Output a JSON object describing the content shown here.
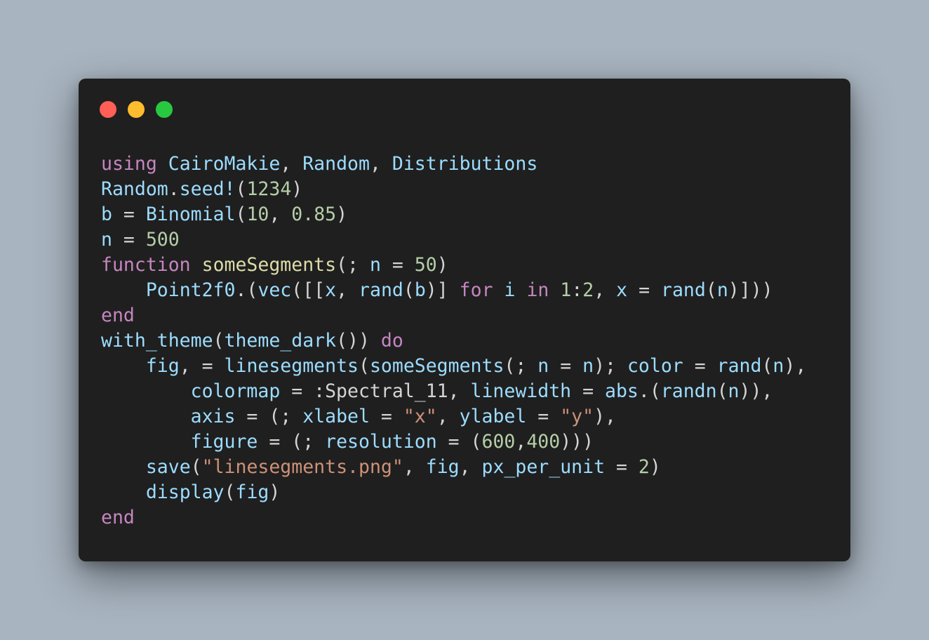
{
  "window": {
    "controls": [
      "close",
      "minimize",
      "zoom"
    ],
    "colors": {
      "close": "#ff5f57",
      "minimize": "#febc2e",
      "zoom": "#28c840",
      "background": "#1f1f1f",
      "page": "#a8b4c0"
    }
  },
  "code": {
    "language": "julia",
    "lines": [
      [
        [
          "kw",
          "using"
        ],
        [
          "pn",
          " "
        ],
        [
          "id",
          "CairoMakie"
        ],
        [
          "pn",
          ", "
        ],
        [
          "id",
          "Random"
        ],
        [
          "pn",
          ", "
        ],
        [
          "id",
          "Distributions"
        ]
      ],
      [
        [
          "id",
          "Random"
        ],
        [
          "pn",
          "."
        ],
        [
          "id",
          "seed!"
        ],
        [
          "pn",
          "("
        ],
        [
          "num",
          "1234"
        ],
        [
          "pn",
          ")"
        ]
      ],
      [
        [
          "id",
          "b"
        ],
        [
          "pn",
          " = "
        ],
        [
          "id",
          "Binomial"
        ],
        [
          "pn",
          "("
        ],
        [
          "num",
          "10"
        ],
        [
          "pn",
          ", "
        ],
        [
          "num",
          "0.85"
        ],
        [
          "pn",
          ")"
        ]
      ],
      [
        [
          "id",
          "n"
        ],
        [
          "pn",
          " = "
        ],
        [
          "num",
          "500"
        ]
      ],
      [
        [
          "kw",
          "function"
        ],
        [
          "pn",
          " "
        ],
        [
          "fn",
          "someSegments"
        ],
        [
          "pn",
          "(; "
        ],
        [
          "id",
          "n"
        ],
        [
          "pn",
          " = "
        ],
        [
          "num",
          "50"
        ],
        [
          "pn",
          ")"
        ]
      ],
      [
        [
          "pn",
          "    "
        ],
        [
          "id",
          "Point2f0"
        ],
        [
          "pn",
          ".("
        ],
        [
          "id",
          "vec"
        ],
        [
          "pn",
          "([["
        ],
        [
          "id",
          "x"
        ],
        [
          "pn",
          ", "
        ],
        [
          "id",
          "rand"
        ],
        [
          "pn",
          "("
        ],
        [
          "id",
          "b"
        ],
        [
          "pn",
          ")] "
        ],
        [
          "kw",
          "for"
        ],
        [
          "pn",
          " "
        ],
        [
          "id",
          "i"
        ],
        [
          "pn",
          " "
        ],
        [
          "kw",
          "in"
        ],
        [
          "pn",
          " "
        ],
        [
          "num",
          "1"
        ],
        [
          "pn",
          ":"
        ],
        [
          "num",
          "2"
        ],
        [
          "pn",
          ", "
        ],
        [
          "id",
          "x"
        ],
        [
          "pn",
          " = "
        ],
        [
          "id",
          "rand"
        ],
        [
          "pn",
          "("
        ],
        [
          "id",
          "n"
        ],
        [
          "pn",
          ")]))"
        ]
      ],
      [
        [
          "kw",
          "end"
        ]
      ],
      [
        [
          "id",
          "with_theme"
        ],
        [
          "pn",
          "("
        ],
        [
          "id",
          "theme_dark"
        ],
        [
          "pn",
          "()) "
        ],
        [
          "kw",
          "do"
        ]
      ],
      [
        [
          "pn",
          "    "
        ],
        [
          "id",
          "fig"
        ],
        [
          "pn",
          ", = "
        ],
        [
          "id",
          "linesegments"
        ],
        [
          "pn",
          "("
        ],
        [
          "id",
          "someSegments"
        ],
        [
          "pn",
          "(; "
        ],
        [
          "id",
          "n"
        ],
        [
          "pn",
          " = "
        ],
        [
          "id",
          "n"
        ],
        [
          "pn",
          "); "
        ],
        [
          "id",
          "color"
        ],
        [
          "pn",
          " = "
        ],
        [
          "id",
          "rand"
        ],
        [
          "pn",
          "("
        ],
        [
          "id",
          "n"
        ],
        [
          "pn",
          "),"
        ]
      ],
      [
        [
          "pn",
          "        "
        ],
        [
          "id",
          "colormap"
        ],
        [
          "pn",
          " = :Spectral_11, "
        ],
        [
          "id",
          "linewidth"
        ],
        [
          "pn",
          " = "
        ],
        [
          "id",
          "abs"
        ],
        [
          "pn",
          ".("
        ],
        [
          "id",
          "randn"
        ],
        [
          "pn",
          "("
        ],
        [
          "id",
          "n"
        ],
        [
          "pn",
          ")),"
        ]
      ],
      [
        [
          "pn",
          "        "
        ],
        [
          "id",
          "axis"
        ],
        [
          "pn",
          " = (; "
        ],
        [
          "id",
          "xlabel"
        ],
        [
          "pn",
          " = "
        ],
        [
          "str",
          "\"x\""
        ],
        [
          "pn",
          ", "
        ],
        [
          "id",
          "ylabel"
        ],
        [
          "pn",
          " = "
        ],
        [
          "str",
          "\"y\""
        ],
        [
          "pn",
          "),"
        ]
      ],
      [
        [
          "pn",
          "        "
        ],
        [
          "id",
          "figure"
        ],
        [
          "pn",
          " = (; "
        ],
        [
          "id",
          "resolution"
        ],
        [
          "pn",
          " = ("
        ],
        [
          "num",
          "600"
        ],
        [
          "pn",
          ","
        ],
        [
          "num",
          "400"
        ],
        [
          "pn",
          ")))"
        ]
      ],
      [
        [
          "pn",
          "    "
        ],
        [
          "id",
          "save"
        ],
        [
          "pn",
          "("
        ],
        [
          "str",
          "\"linesegments.png\""
        ],
        [
          "pn",
          ", "
        ],
        [
          "id",
          "fig"
        ],
        [
          "pn",
          ", "
        ],
        [
          "id",
          "px_per_unit"
        ],
        [
          "pn",
          " = "
        ],
        [
          "num",
          "2"
        ],
        [
          "pn",
          ")"
        ]
      ],
      [
        [
          "pn",
          "    "
        ],
        [
          "id",
          "display"
        ],
        [
          "pn",
          "("
        ],
        [
          "id",
          "fig"
        ],
        [
          "pn",
          ")"
        ]
      ],
      [
        [
          "kw",
          "end"
        ]
      ]
    ]
  }
}
